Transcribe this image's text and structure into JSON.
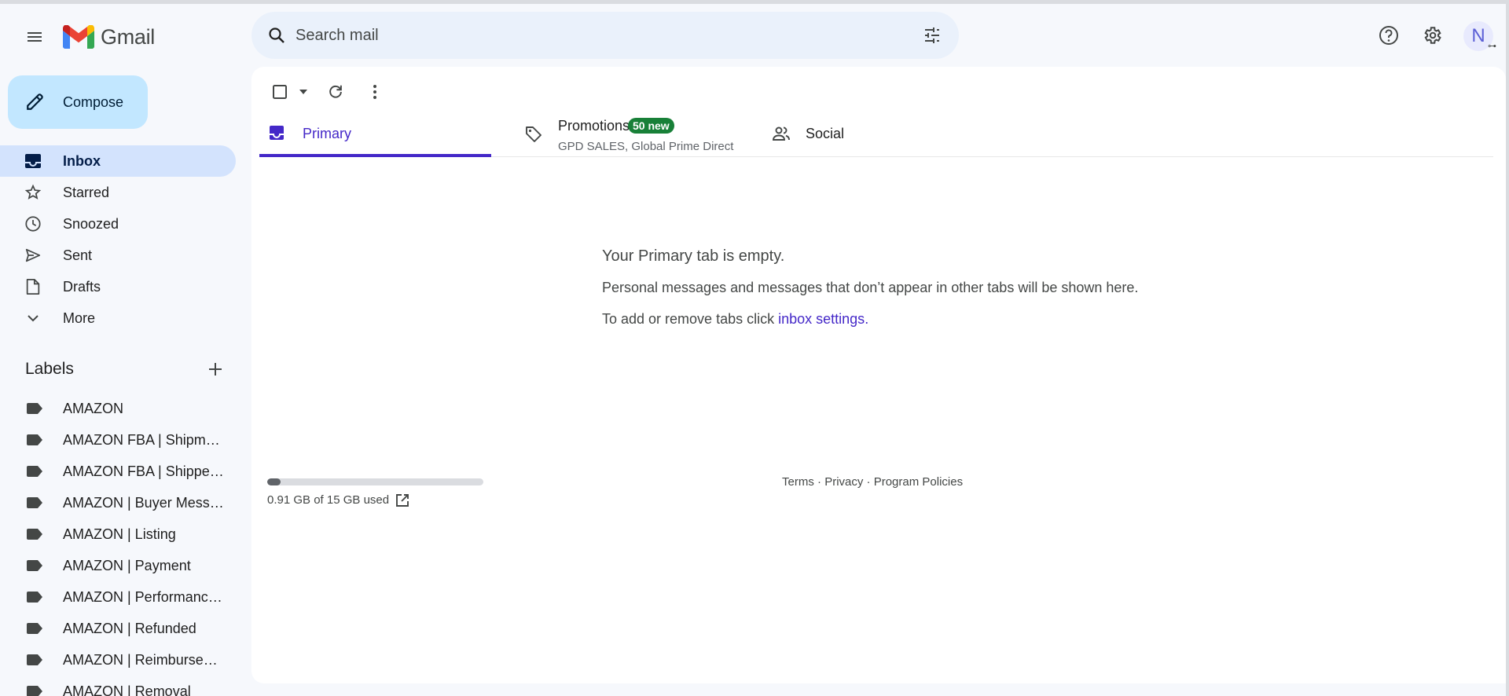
{
  "app": {
    "name": "Gmail"
  },
  "search": {
    "placeholder": "Search mail"
  },
  "account": {
    "initial": "N"
  },
  "compose": {
    "label": "Compose"
  },
  "nav": {
    "items": [
      {
        "label": "Inbox",
        "icon": "inbox-icon",
        "active": true
      },
      {
        "label": "Starred",
        "icon": "star-icon"
      },
      {
        "label": "Snoozed",
        "icon": "clock-icon"
      },
      {
        "label": "Sent",
        "icon": "send-icon"
      },
      {
        "label": "Drafts",
        "icon": "draft-icon"
      },
      {
        "label": "More",
        "icon": "chevron-down-icon"
      }
    ]
  },
  "labels": {
    "heading": "Labels",
    "items": [
      "AMAZON",
      "AMAZON FBA | Shipmen...",
      "AMAZON FBA | Shipped...",
      "AMAZON | Buyer Messa...",
      "AMAZON | Listing",
      "AMAZON | Payment",
      "AMAZON | Performance...",
      "AMAZON | Refunded",
      "AMAZON | Reimbursem...",
      "AMAZON | Removal"
    ]
  },
  "tabs": {
    "primary": {
      "label": "Primary"
    },
    "promotions": {
      "label": "Promotions",
      "badge": "50 new",
      "subtitle": "GPD SALES, Global Prime Direct"
    },
    "social": {
      "label": "Social"
    }
  },
  "empty_state": {
    "title": "Your Primary tab is empty.",
    "description": "Personal messages and messages that don’t appear in other tabs will be shown here.",
    "settings_prefix": "To add or remove tabs click ",
    "settings_link": "inbox settings",
    "settings_suffix": "."
  },
  "storage": {
    "used_text": "0.91 GB of 15 GB used",
    "used_fraction": 0.06
  },
  "footer": {
    "terms": "Terms",
    "privacy": "Privacy",
    "policies": "Program Policies",
    "separator": " · "
  },
  "colors": {
    "accent": "#4428c8",
    "compose_bg": "#c2e7ff",
    "active_nav": "#d3e3fd",
    "badge_green": "#188038",
    "search_bg": "#eaf1fb"
  }
}
